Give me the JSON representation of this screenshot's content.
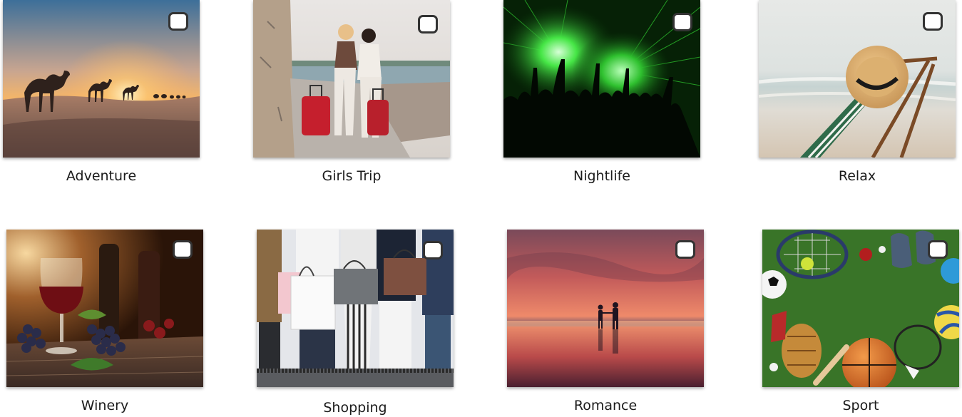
{
  "categories": [
    {
      "id": "adventure",
      "label": "Adventure",
      "checked": false,
      "image": "desert camel caravan at sunset"
    },
    {
      "id": "girls-trip",
      "label": "Girls Trip",
      "checked": false,
      "image": "two women with red suitcases on seaside path"
    },
    {
      "id": "nightlife",
      "label": "Nightlife",
      "checked": false,
      "image": "concert crowd under green lasers"
    },
    {
      "id": "relax",
      "label": "Relax",
      "checked": false,
      "image": "straw hat on beach deck chair"
    },
    {
      "id": "winery",
      "label": "Winery",
      "checked": false,
      "image": "glass of red wine with grapes"
    },
    {
      "id": "shopping",
      "label": "Shopping",
      "checked": false,
      "image": "women carrying shopping bags"
    },
    {
      "id": "romance",
      "label": "Romance",
      "checked": false,
      "image": "couple walking on beach at sunset"
    },
    {
      "id": "sport",
      "label": "Sport",
      "checked": false,
      "image": "sports balls and equipment on grass"
    }
  ],
  "colors": {
    "checkbox_border": "#333333",
    "label_text": "#1b1b1b"
  }
}
